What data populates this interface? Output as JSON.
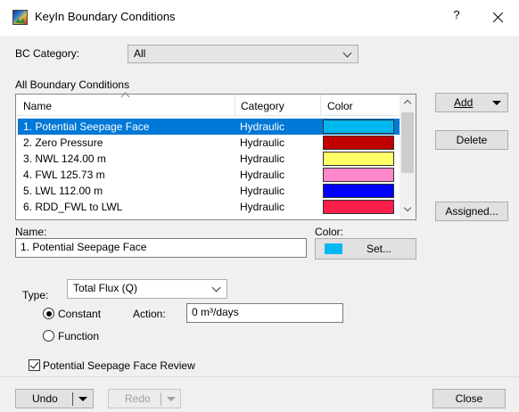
{
  "window": {
    "title": "KeyIn Boundary Conditions",
    "help_label": "?"
  },
  "bc_category": {
    "label": "BC Category:",
    "value": "All"
  },
  "list": {
    "group_label": "All Boundary Conditions",
    "headers": {
      "name": "Name",
      "category": "Category",
      "color": "Color"
    },
    "rows": [
      {
        "name": "1. Potential Seepage Face",
        "category": "Hydraulic",
        "color": "#00b7ef",
        "selected": true
      },
      {
        "name": "2. Zero Pressure",
        "category": "Hydraulic",
        "color": "#c00000",
        "selected": false
      },
      {
        "name": "3. NWL 124.00 m",
        "category": "Hydraulic",
        "color": "#ffff66",
        "selected": false
      },
      {
        "name": "4. FWL 125.73 m",
        "category": "Hydraulic",
        "color": "#ff88cc",
        "selected": false
      },
      {
        "name": "5. LWL 112.00 m",
        "category": "Hydraulic",
        "color": "#0000ff",
        "selected": false
      },
      {
        "name": "6. RDD_FWL to LWL",
        "category": "Hydraulic",
        "color": "#ff1e4a",
        "selected": false
      }
    ]
  },
  "buttons": {
    "add": "Add",
    "delete": "Delete",
    "assigned": "Assigned...",
    "set": "Set...",
    "undo": "Undo",
    "redo": "Redo",
    "close": "Close"
  },
  "name_field": {
    "label": "Name:",
    "value": "1. Potential Seepage Face"
  },
  "color_field": {
    "label": "Color:",
    "value": "#00b7ef"
  },
  "type": {
    "label": "Type:",
    "value": "Total Flux (Q)"
  },
  "mode": {
    "constant_label": "Constant",
    "function_label": "Function",
    "selected": "Constant"
  },
  "action": {
    "label": "Action:",
    "value": "0 m³/days"
  },
  "review": {
    "label": "Potential Seepage Face Review",
    "checked": true
  }
}
